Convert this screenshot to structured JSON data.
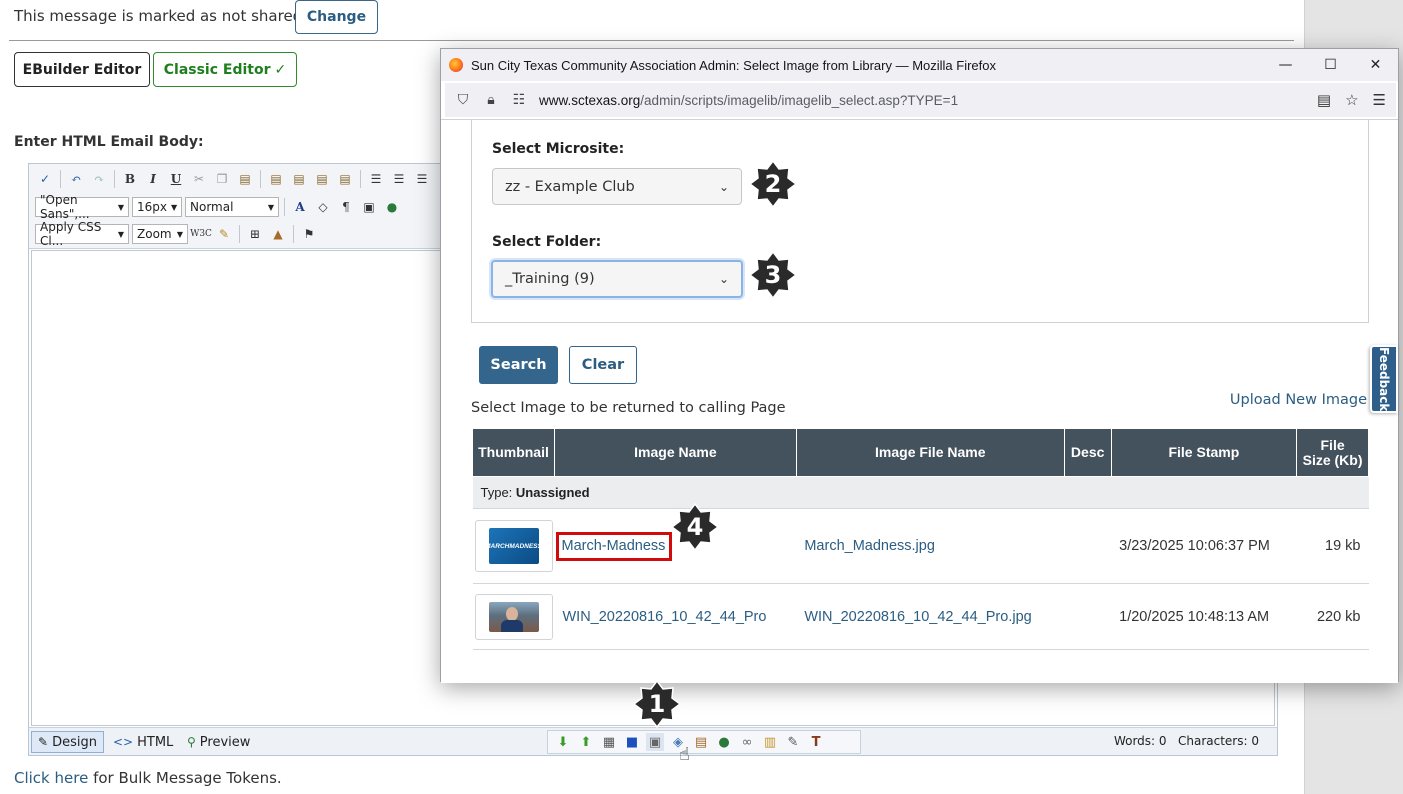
{
  "page": {
    "share_message": "This message is marked as not shared.",
    "change_label": "Change",
    "ebuilder_label": "EBuilder Editor",
    "classic_label": "Classic Editor",
    "classic_check": "✓",
    "email_body_label": "Enter HTML Email Body:",
    "bulk_link": "Click here",
    "bulk_rest": " for Bulk Message Tokens."
  },
  "editor": {
    "font_family": "\"Open Sans\",...",
    "font_size": "16px",
    "paragraph": "Normal",
    "css_class": "Apply CSS Cl...",
    "zoom": "Zoom",
    "modes": [
      "Design",
      "HTML",
      "Preview"
    ],
    "words": "Words: 0",
    "characters": "Characters: 0"
  },
  "popup": {
    "window_title": "Sun City Texas Community Association Admin: Select Image from Library — Mozilla Firefox",
    "url_host": "www.sctexas.org",
    "url_path": "/admin/scripts/imagelib/imagelib_select.asp?TYPE=1",
    "microsite_label": "Select Microsite:",
    "microsite_value": "zz - Example Club",
    "folder_label": "Select Folder:",
    "folder_value": "_Training (9)",
    "search_label": "Search",
    "clear_label": "Clear",
    "select_heading": "Select Image to be returned to calling Page",
    "upload_link": "Upload New Image",
    "columns": [
      "Thumbnail",
      "Image Name",
      "Image File Name",
      "Desc",
      "File Stamp",
      "File",
      "Size (Kb)"
    ],
    "type_label": "Type:",
    "type_value": "Unassigned",
    "rows": [
      {
        "image_name": "March-Madness",
        "file_name": "March_Madness.jpg",
        "desc": "",
        "stamp": "3/23/2025 10:06:37 PM",
        "size": "19 kb",
        "thumb_text_1": "MARCH",
        "thumb_text_2": "MADNESS"
      },
      {
        "image_name": "WIN_20220816_10_42_44_Pro",
        "file_name": "WIN_20220816_10_42_44_Pro.jpg",
        "desc": "",
        "stamp": "1/20/2025 10:48:13 AM",
        "size": "220 kb"
      }
    ],
    "feedback_label": "Feedback"
  },
  "badges": [
    "1",
    "2",
    "3",
    "4"
  ],
  "colors": {
    "accent": "#34658d",
    "highlight": "#d10b0b",
    "table_header": "#44525e",
    "badge": "#2a2a2a"
  }
}
